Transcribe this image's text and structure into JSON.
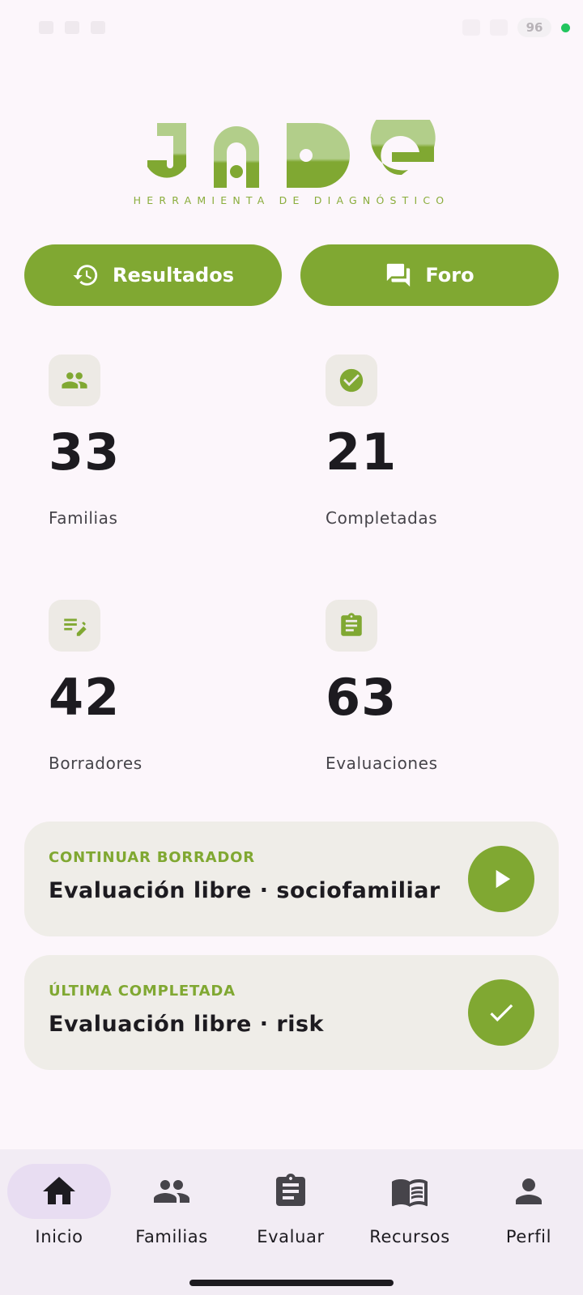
{
  "status_bar": {
    "battery": "96"
  },
  "logo": {
    "brand": "JADE",
    "tagline": "HERRAMIENTA DE DIAGNÓSTICO",
    "color_light": "#b2ce8a",
    "color_dark": "#80a832"
  },
  "actions": {
    "results_label": "Resultados",
    "results_icon": "history-icon",
    "forum_label": "Foro",
    "forum_icon": "forum-icon"
  },
  "stats": [
    {
      "value": "33",
      "label": "Familias",
      "icon": "group-icon"
    },
    {
      "value": "21",
      "label": "Completadas",
      "icon": "check-circle-icon"
    },
    {
      "value": "42",
      "label": "Borradores",
      "icon": "edit-note-icon"
    },
    {
      "value": "63",
      "label": "Evaluaciones",
      "icon": "clipboard-icon"
    }
  ],
  "cards": {
    "draft": {
      "label": "CONTINUAR BORRADOR",
      "title": "Evaluación libre · sociofamiliar",
      "icon": "play-icon"
    },
    "last": {
      "label": "ÚLTIMA COMPLETADA",
      "title": "Evaluación libre · risk",
      "icon": "check-icon"
    }
  },
  "nav": [
    {
      "label": "Inicio",
      "icon": "home-icon",
      "active": true
    },
    {
      "label": "Familias",
      "icon": "group-icon",
      "active": false
    },
    {
      "label": "Evaluar",
      "icon": "clipboard-icon",
      "active": false
    },
    {
      "label": "Recursos",
      "icon": "book-icon",
      "active": false
    },
    {
      "label": "Perfil",
      "icon": "person-icon",
      "active": false
    }
  ],
  "colors": {
    "accent": "#80a832",
    "background": "#fcf6fb",
    "card_bg": "#efede8",
    "nav_bg": "#f2ecf4",
    "nav_active": "#e8ddf2"
  }
}
